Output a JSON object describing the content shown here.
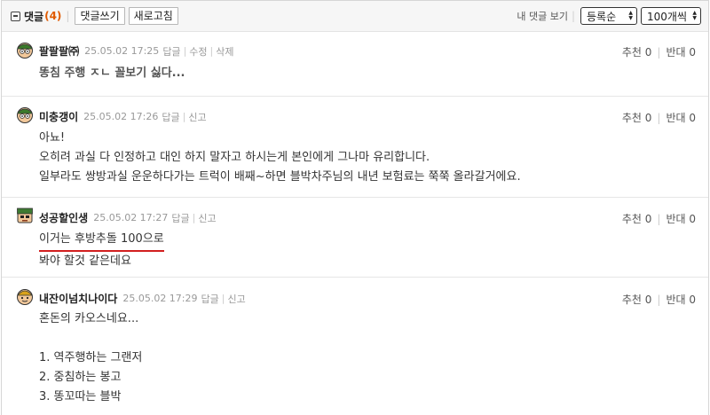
{
  "header": {
    "title": "댓글",
    "count": "(4)",
    "write_button": "댓글쓰기",
    "refresh_button": "새로고침",
    "my_comments": "내 댓글 보기",
    "order_select": "등록순",
    "perpage_select": "100개씩"
  },
  "comments": [
    {
      "nick": "팔팔팔㈜",
      "date": "25.05.02 17:25",
      "actions": [
        "답글",
        "수정",
        "삭제"
      ],
      "recommend": "추천 0",
      "oppose": "반대 0",
      "lines": [
        "똥침 주행 ㅈㄴ 꼴보기 싫다..."
      ]
    },
    {
      "nick": "미충갱이",
      "date": "25.05.02 17:26",
      "actions": [
        "답글",
        "신고"
      ],
      "recommend": "추천 0",
      "oppose": "반대 0",
      "lines": [
        "아뇨!",
        "오히려 과실 다 인정하고 대인 하지 말자고 하시는게 본인에게 그나마 유리합니다.",
        "일부라도 쌍방과실 운운하다가는 트럭이 배째~하면 블박차주님의 내년 보험료는 쭉쭉 올라갈거에요."
      ]
    },
    {
      "nick": "성공할인생",
      "date": "25.05.02 17:27",
      "actions": [
        "답글",
        "신고"
      ],
      "recommend": "추천 0",
      "oppose": "반대 0",
      "lines": [
        "이거는 후방추돌 100으로",
        "봐야 할것 같은데요"
      ]
    },
    {
      "nick": "내잔이넘치나이다",
      "date": "25.05.02 17:29",
      "actions": [
        "답글",
        "신고"
      ],
      "recommend": "추천 0",
      "oppose": "반대 0",
      "lines": [
        "혼돈의 카오스네요...",
        "",
        "1. 역주행하는 그랜저",
        "2. 중침하는 봉고",
        "3. 똥꼬따는 블박"
      ]
    }
  ],
  "colors": {
    "count": "#e05a00",
    "underline": "#d21f1f",
    "bar_bg": "#f6f6f6"
  }
}
